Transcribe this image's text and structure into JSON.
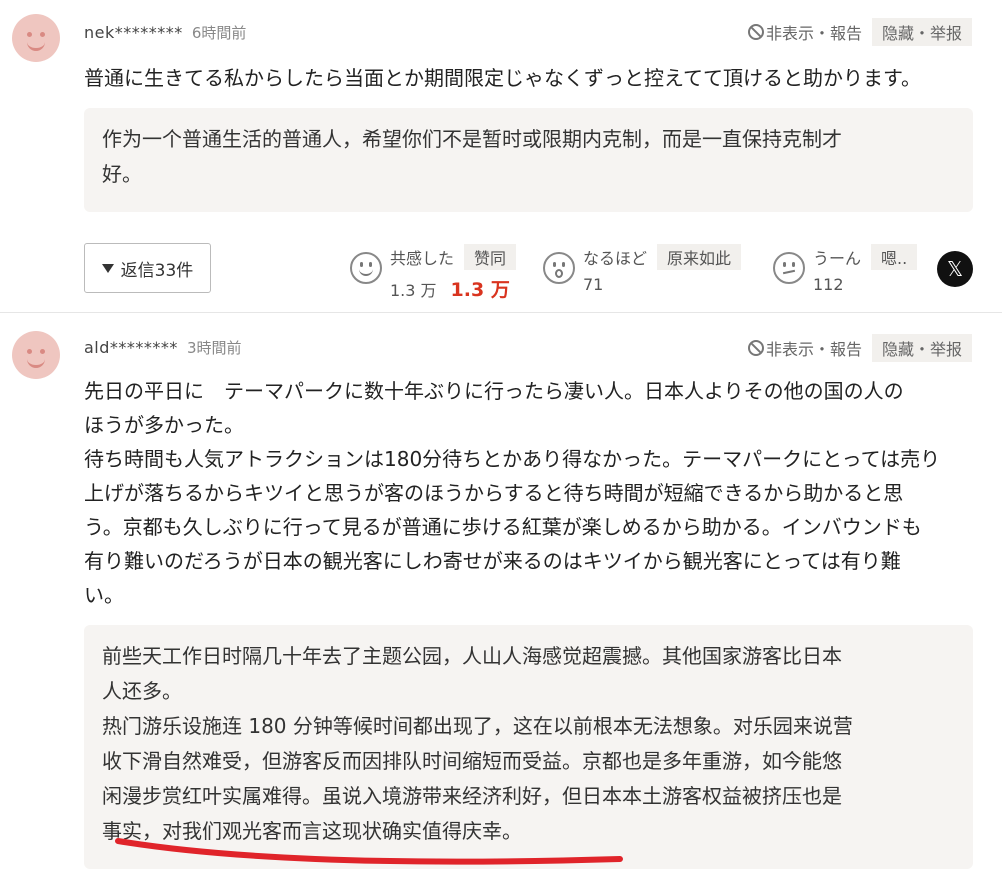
{
  "comments": [
    {
      "user": "nek********",
      "time": "6時間前",
      "hide_label": "非表示・報告",
      "hide_translation": "隐藏・举报",
      "text": "普通に生きてる私からしたら当面とか期間限定じゃなくずっと控えてて頂けると助かります。",
      "translation": "作为一个普通生活的普通人，希望你们不是暂时或限期内克制，而是一直保持克制才\n好。",
      "reply_label": "返信33件",
      "reactions": [
        {
          "label": "共感した",
          "tag": "赞同",
          "count": "1.3 万",
          "count_tr": "1.3 万",
          "icon": "smile-icon"
        },
        {
          "label": "なるほど",
          "tag": "原来如此",
          "count": "71",
          "icon": "surprised-icon"
        },
        {
          "label": "うーん",
          "tag": "嗯..",
          "count": "112",
          "icon": "thinking-icon"
        }
      ],
      "share_x": "𝕏"
    },
    {
      "user": "ald********",
      "time": "3時間前",
      "hide_label": "非表示・報告",
      "hide_translation": "隐藏・举报",
      "text": "先日の平日に　テーマパークに数十年ぶりに行ったら凄い人。日本人よりその他の国の人の\nほうが多かった。\n待ち時間も人気アトラクションは180分待ちとかあり得なかった。テーマパークにとっては売り\n上げが落ちるからキツイと思うが客のほうからすると待ち時間が短縮できるから助かると思\nう。京都も久しぶりに行って見るが普通に歩ける紅葉が楽しめるから助かる。インバウンドも\n有り難いのだろうが日本の観光客にしわ寄せが来るのはキツイから観光客にとっては有り難\nい。",
      "translation": "前些天工作日时隔几十年去了主题公园，人山人海感觉超震撼。其他国家游客比日本\n人还多。\n热门游乐设施连 180 分钟等候时间都出现了，这在以前根本无法想象。对乐园来说营\n收下滑自然难受，但游客反而因排队时间缩短而受益。京都也是多年重游，如今能悠\n闲漫步赏红叶实属难得。虽说入境游带来经济利好，但日本本土游客权益被挤压也是\n事实，对我们观光客而言这现状确实值得庆幸。"
    }
  ],
  "colors": {
    "highlight_count": "#d9341f",
    "underline": "#e0242a",
    "avatar": "#efc6c0"
  }
}
